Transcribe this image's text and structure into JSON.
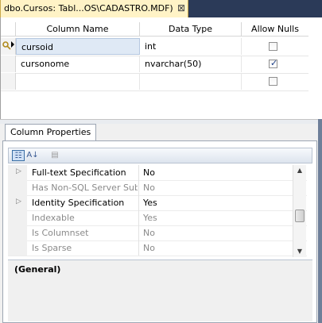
{
  "tab": {
    "title": "dbo.Cursos: Tabl...OS\\CADASTRO.MDF)",
    "close": "⊠"
  },
  "grid": {
    "headers": [
      "Column Name",
      "Data Type",
      "Allow Nulls"
    ],
    "rows": [
      {
        "name": "cursoid",
        "type": "int",
        "allow_nulls": false,
        "key": true
      },
      {
        "name": "cursonome",
        "type": "nvarchar(50)",
        "allow_nulls": true,
        "key": false
      },
      {
        "name": "",
        "type": "",
        "allow_nulls": false,
        "key": false
      }
    ]
  },
  "properties": {
    "tab_label": "Column Properties",
    "items": [
      {
        "name": "Full-text Specification",
        "value": "No",
        "expandable": true,
        "enabled": true
      },
      {
        "name": "Has Non-SQL Server Sub",
        "value": "No",
        "expandable": false,
        "enabled": false
      },
      {
        "name": "Identity Specification",
        "value": "Yes",
        "expandable": true,
        "enabled": true
      },
      {
        "name": "Indexable",
        "value": "Yes",
        "expandable": false,
        "enabled": false
      },
      {
        "name": "Is Columnset",
        "value": "No",
        "expandable": false,
        "enabled": false
      },
      {
        "name": "Is Sparse",
        "value": "No",
        "expandable": false,
        "enabled": false
      }
    ],
    "description_title": "(General)"
  }
}
